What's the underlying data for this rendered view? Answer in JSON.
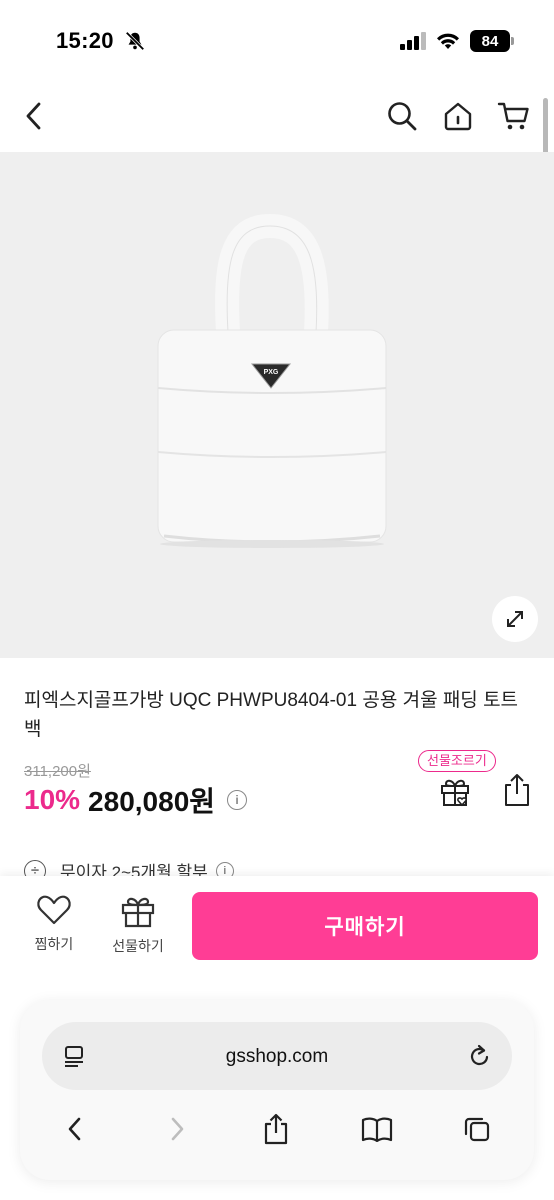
{
  "status_bar": {
    "time": "15:20",
    "battery": "84"
  },
  "product": {
    "name": "피엑스지골프가방 UQC PHWPU8404-01 공용 겨울 패딩 토트 백",
    "original_price": "311,200원",
    "discount": "10%",
    "sale_price": "280,080원",
    "gift_badge": "선물조르기",
    "installment": "무이자 2~5개월 할부",
    "info_glyph": "i"
  },
  "actions": {
    "wish_label": "찜하기",
    "gift_label": "선물하기",
    "buy_label": "구매하기"
  },
  "browser": {
    "url": "gsshop.com"
  },
  "colors": {
    "accent": "#ff3d95",
    "discount": "#ec2a8c",
    "image_bg": "#efefef"
  },
  "icons": [
    "back-icon",
    "search-icon",
    "home-icon",
    "cart-icon",
    "expand-icon",
    "gift-icon",
    "share-icon",
    "heart-icon",
    "reader-icon",
    "reload-icon",
    "forward-icon",
    "bookmarks-icon",
    "tabs-icon"
  ]
}
